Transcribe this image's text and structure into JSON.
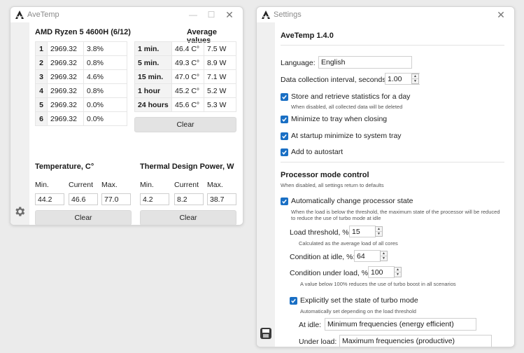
{
  "main_window": {
    "title": "AveTemp",
    "cpu_name": "AMD Ryzen 5 4600H (6/12)",
    "avg_title": "Average values",
    "cores": [
      {
        "index": "1",
        "freq": "2969.32",
        "load": "3.8%"
      },
      {
        "index": "2",
        "freq": "2969.32",
        "load": "0.8%"
      },
      {
        "index": "3",
        "freq": "2969.32",
        "load": "4.6%"
      },
      {
        "index": "4",
        "freq": "2969.32",
        "load": "0.8%"
      },
      {
        "index": "5",
        "freq": "2969.32",
        "load": "0.0%"
      },
      {
        "index": "6",
        "freq": "2969.32",
        "load": "0.0%"
      }
    ],
    "averages": [
      {
        "period": "1 min.",
        "temp": "46.4 C°",
        "power": "7.5 W"
      },
      {
        "period": "5 min.",
        "temp": "49.3 C°",
        "power": "8.9 W"
      },
      {
        "period": "15 min.",
        "temp": "47.0 C°",
        "power": "7.1 W"
      },
      {
        "period": "1 hour",
        "temp": "45.2 C°",
        "power": "5.2 W"
      },
      {
        "period": "24 hours",
        "temp": "45.6 C°",
        "power": "5.3 W"
      }
    ],
    "avg_clear": "Clear",
    "temperature": {
      "title": "Temperature, C°",
      "min_label": "Min.",
      "current_label": "Current",
      "max_label": "Max.",
      "min": "44.2",
      "current": "46.6",
      "max": "77.0",
      "clear": "Clear"
    },
    "tdp": {
      "title": "Thermal Design Power, W",
      "min_label": "Min.",
      "current_label": "Current",
      "max_label": "Max.",
      "min": "4.2",
      "current": "8.2",
      "max": "38.7",
      "clear": "Clear"
    }
  },
  "settings_window": {
    "title": "Settings",
    "version": "AveTemp 1.4.0",
    "language_label": "Language:",
    "language_value": "English",
    "interval_label": "Data collection interval, seconds:",
    "interval_value": "1.00",
    "store_stats": "Store and retrieve statistics for a day",
    "store_stats_hint": "When disabled, all collected data will be deleted",
    "minimize_tray": "Minimize to tray when closing",
    "startup_minimize": "At startup minimize to system tray",
    "autostart": "Add to autostart",
    "processor_title": "Processor mode control",
    "processor_hint": "When disabled, all settings return to defaults",
    "auto_change": "Automatically change processor state",
    "auto_change_hint_1": "When the load is below the threshold, the maximum state of the processor will be reduced",
    "auto_change_hint_2": "to reduce the use of turbo mode at idle",
    "load_threshold_label": "Load threshold, %:",
    "load_threshold_value": "15",
    "load_threshold_hint": "Calculated as the average load of all cores",
    "idle_label": "Condition at idle, %:",
    "idle_value": "64",
    "load_label": "Condition under load, %:",
    "load_value": "100",
    "load_hint": "A value below 100% reduces the use of turbo boost in all scenarios",
    "turbo_label": "Explicitly set the state of turbo mode",
    "turbo_hint": "Automatically set depending on the load threshold",
    "at_idle_label": "At idle:",
    "at_idle_value": "Minimum frequencies (energy efficient)",
    "under_load_label": "Under load:",
    "under_load_value": "Maximum frequencies (productive)"
  },
  "colors": {
    "checkbox": "#1a6fc4",
    "background": "#ebebeb"
  }
}
